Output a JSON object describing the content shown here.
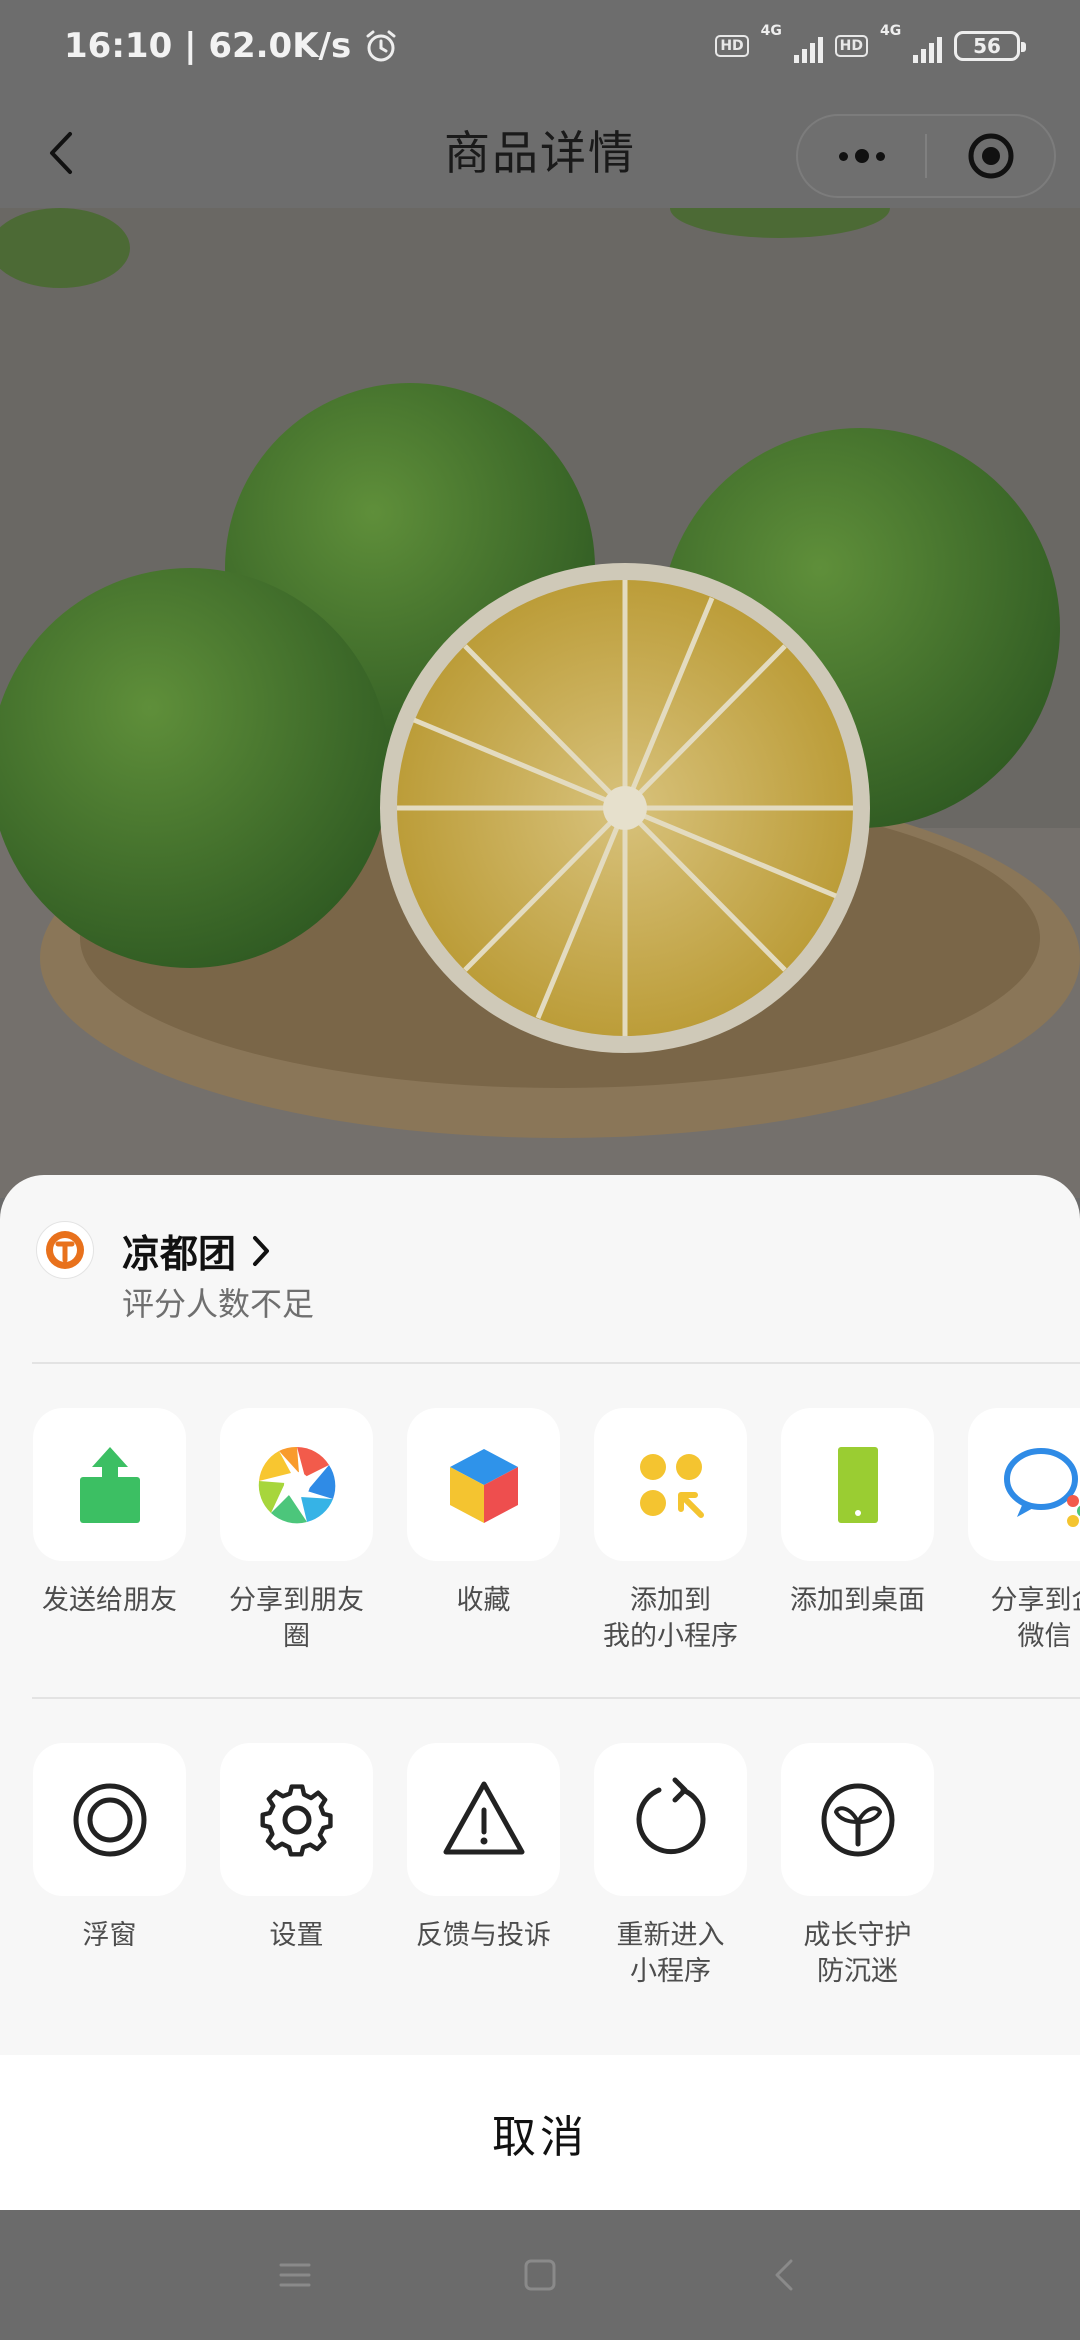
{
  "status_bar": {
    "time_speed": "16:10 | 62.0K/s",
    "sim1": {
      "hd": "HD",
      "net": "4G"
    },
    "sim2": {
      "hd": "HD",
      "net": "4G"
    },
    "battery": "56"
  },
  "nav": {
    "title": "商品详情"
  },
  "product_image": {
    "subject": "green citrus oranges on bamboo tray"
  },
  "mini_program": {
    "name": "凉都团",
    "rating_text": "评分人数不足",
    "logo_color": "#e8711c"
  },
  "share_actions": [
    {
      "label": "发送给朋友",
      "icon": "send-to-friend-icon"
    },
    {
      "label": "分享到朋友\n圈",
      "icon": "moments-icon"
    },
    {
      "label": "收藏",
      "icon": "favorite-cube-icon"
    },
    {
      "label": "添加到\n我的小程序",
      "icon": "add-mini-program-icon"
    },
    {
      "label": "添加到桌面",
      "icon": "add-to-desktop-icon"
    },
    {
      "label": "分享到企\n微信",
      "icon": "wecom-icon"
    }
  ],
  "tool_actions": [
    {
      "label": "浮窗",
      "icon": "floating-window-icon"
    },
    {
      "label": "设置",
      "icon": "settings-gear-icon"
    },
    {
      "label": "反馈与投诉",
      "icon": "warning-triangle-icon"
    },
    {
      "label": "重新进入\n小程序",
      "icon": "reload-icon"
    },
    {
      "label": "成长守护\n防沉迷",
      "icon": "growth-guard-icon"
    }
  ],
  "cancel_label": "取消",
  "colors": {
    "dim_overlay": "#6d6d6d",
    "sheet_bg": "#f7f7f7",
    "tile_bg": "#ffffff",
    "send_green": "#3cbf63",
    "favorite_yellow": "#f4c430",
    "desktop_green": "#9acd32"
  }
}
